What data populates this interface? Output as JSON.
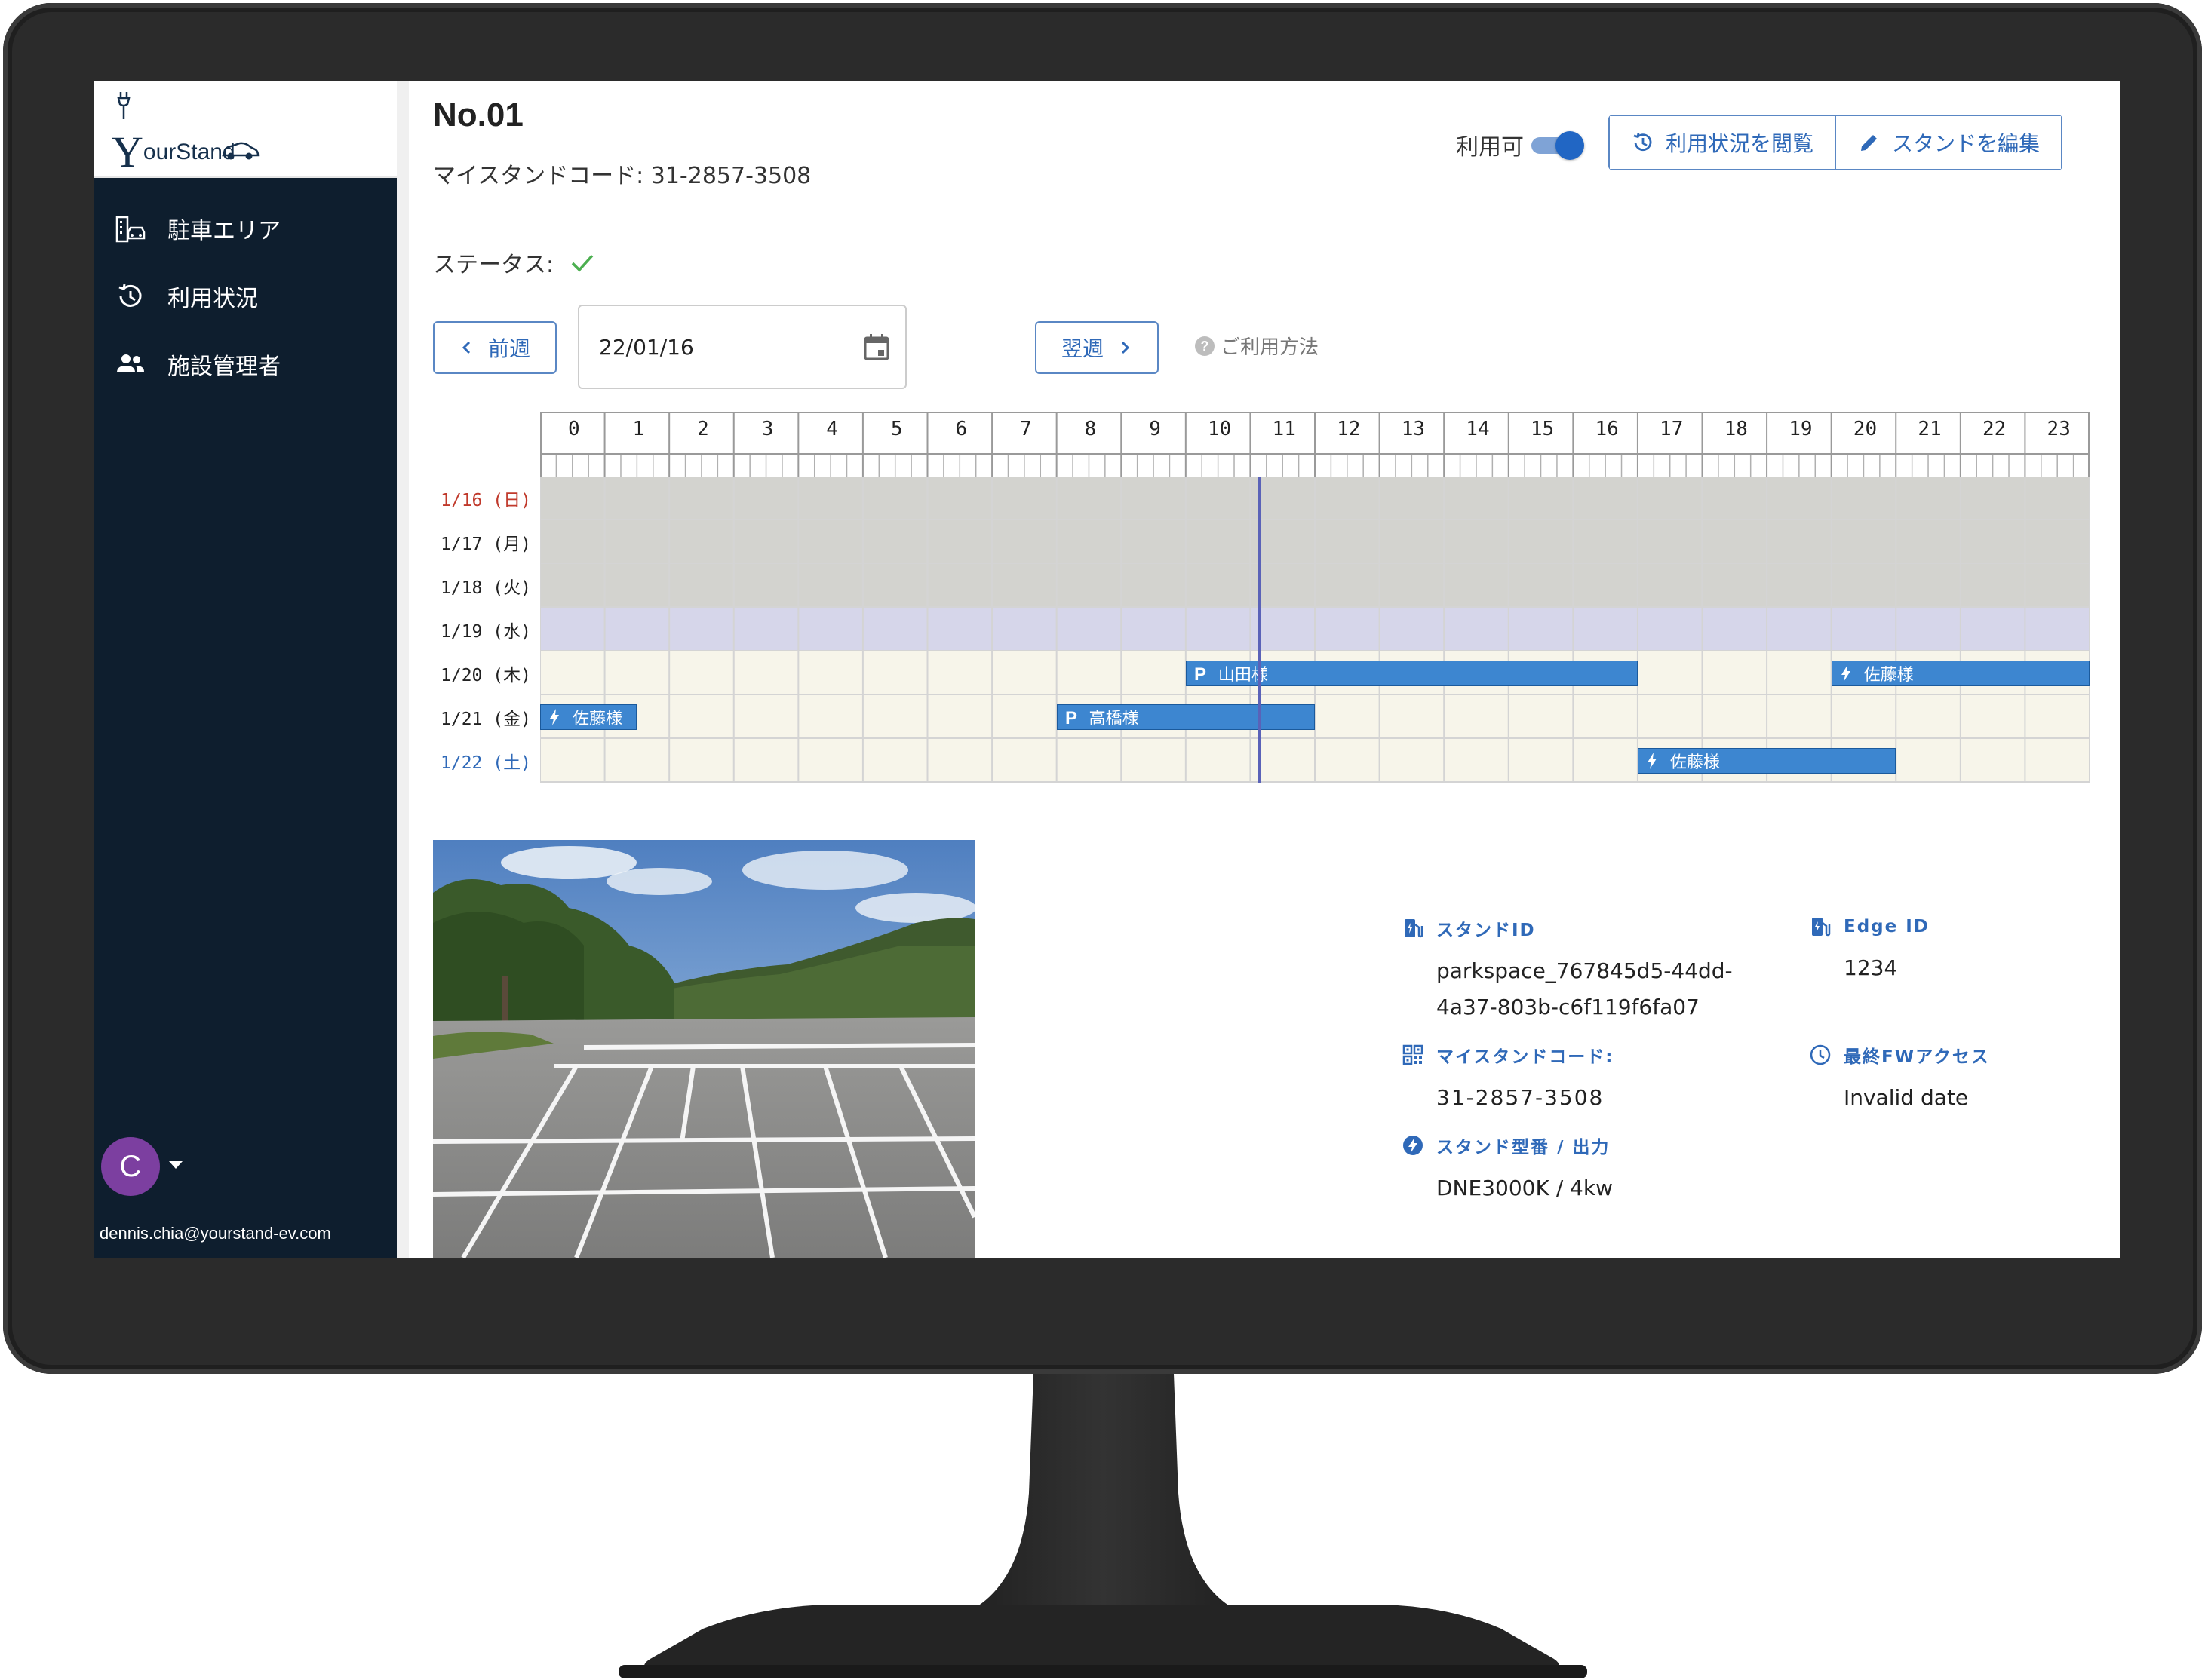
{
  "app": {
    "logo_text": "ourStand",
    "logo_initial": "Y"
  },
  "sidebar": {
    "items": [
      {
        "label": "駐車エリア",
        "icon": "parking-building-icon"
      },
      {
        "label": "利用状況",
        "icon": "history-icon"
      },
      {
        "label": "施設管理者",
        "icon": "people-icon"
      }
    ],
    "user_initial": "C",
    "user_email": "dennis.chia@yourstand-ev.com"
  },
  "header": {
    "title": "No.01",
    "code_line": "マイスタンドコード: 31-2857-3508",
    "status_label": "ステータス:",
    "availability_label": "利用可",
    "availability_on": true,
    "view_usage_label": "利用状況を閲覧",
    "edit_stand_label": "スタンドを編集"
  },
  "week_nav": {
    "prev_label": "前週",
    "next_label": "翌週",
    "date_value": "22/01/16",
    "help_label": "ご利用方法"
  },
  "schedule": {
    "hours": [
      "0",
      "1",
      "2",
      "3",
      "4",
      "5",
      "6",
      "7",
      "8",
      "9",
      "10",
      "11",
      "12",
      "13",
      "14",
      "15",
      "16",
      "17",
      "18",
      "19",
      "20",
      "21",
      "22",
      "23"
    ],
    "now_hour": 11.15,
    "days": [
      {
        "label": "1/16 (日)",
        "color": "#c0392b",
        "state": "past"
      },
      {
        "label": "1/17 (月)",
        "color": "#222222",
        "state": "past"
      },
      {
        "label": "1/18 (火)",
        "color": "#222222",
        "state": "past"
      },
      {
        "label": "1/19 (水)",
        "color": "#222222",
        "state": "today"
      },
      {
        "label": "1/20 (木)",
        "color": "#222222",
        "state": "future"
      },
      {
        "label": "1/21 (金)",
        "color": "#222222",
        "state": "future"
      },
      {
        "label": "1/22 (土)",
        "color": "#2f69b8",
        "state": "future"
      }
    ],
    "events": [
      {
        "day": 4,
        "start": 10.0,
        "end": 17.0,
        "kind": "parking",
        "name": "山田様"
      },
      {
        "day": 4,
        "start": 20.0,
        "end": 24.0,
        "kind": "charge",
        "name": "佐藤様"
      },
      {
        "day": 5,
        "start": 0.0,
        "end": 1.5,
        "kind": "charge",
        "name": "佐藤様"
      },
      {
        "day": 5,
        "start": 8.0,
        "end": 12.0,
        "kind": "parking",
        "name": "高橋様"
      },
      {
        "day": 6,
        "start": 17.0,
        "end": 21.0,
        "kind": "charge",
        "name": "佐藤様"
      }
    ],
    "colors": {
      "past": "#d3d3cf",
      "today": "#d6d6ea",
      "future": "#f7f5ea",
      "event": "#3d86d0",
      "now_line": "#5a62b8"
    }
  },
  "info": {
    "stand_id_label": "スタンドID",
    "stand_id_value_1": "parkspace_767845d5-44dd-",
    "stand_id_value_2": "4a37-803b-c6f119f6fa07",
    "edge_id_label": "Edge ID",
    "edge_id_value": "1234",
    "my_code_label": "マイスタンドコード:",
    "my_code_value": "31-2857-3508",
    "fw_label": "最終FWアクセス",
    "fw_value": "Invalid date",
    "model_label": "スタンド型番 / 出力",
    "model_value": "DNE3000K / 4kw"
  }
}
